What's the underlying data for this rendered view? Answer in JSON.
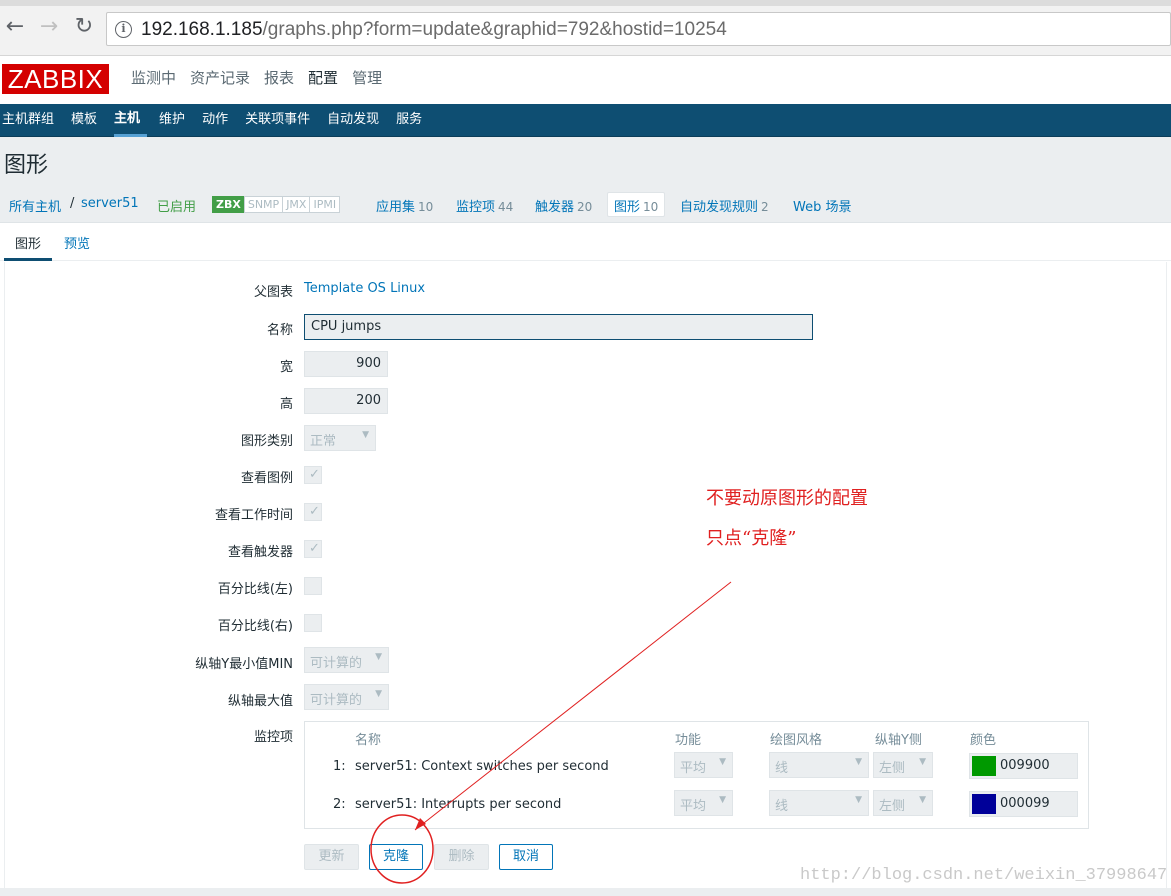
{
  "browser": {
    "url_host": "192.168.1.185",
    "url_rest": "/graphs.php?form=update&graphid=792&hostid=10254",
    "icons": [
      "back-icon",
      "forward-icon",
      "reload-icon",
      "info-icon"
    ]
  },
  "header": {
    "logo": "ZABBIX",
    "menu": [
      "监测中",
      "资产记录",
      "报表",
      "配置",
      "管理"
    ],
    "active_menu": "配置"
  },
  "subnav": {
    "items": [
      "主机群组",
      "模板",
      "主机",
      "维护",
      "动作",
      "关联项事件",
      "自动发现",
      "服务"
    ],
    "active": "主机"
  },
  "page_title": "图形",
  "hostbar": {
    "all_hosts": "所有主机",
    "separator": "/",
    "host": "server51",
    "status": "已启用",
    "badges": [
      "ZBX",
      "SNMP",
      "JMX",
      "IPMI"
    ],
    "apps_label": "应用集",
    "apps_count": "10",
    "items_label": "监控项",
    "items_count": "44",
    "triggers_label": "触发器",
    "triggers_count": "20",
    "graphs_label": "图形",
    "graphs_count": "10",
    "discovery_label": "自动发现规则",
    "discovery_count": "2",
    "web_label": "Web 场景"
  },
  "tabs": [
    "图形",
    "预览"
  ],
  "form": {
    "parent_label": "父图表",
    "parent_value": "Template OS Linux",
    "name_label": "名称",
    "name_value": "CPU jumps",
    "width_label": "宽",
    "width_value": "900",
    "height_label": "高",
    "height_value": "200",
    "type_label": "图形类别",
    "type_value": "正常",
    "legend_label": "查看图例",
    "worktime_label": "查看工作时间",
    "triggers_label": "查看触发器",
    "pct_left_label": "百分比线(左)",
    "pct_right_label": "百分比线(右)",
    "ymin_label": "纵轴Y最小值MIN",
    "ymin_value": "可计算的",
    "ymax_label": "纵轴最大值",
    "ymax_value": "可计算的",
    "items_label": "监控项"
  },
  "items_table": {
    "headers": [
      "名称",
      "功能",
      "绘图风格",
      "纵轴Y侧",
      "颜色"
    ],
    "rows": [
      {
        "index": "1:",
        "name": "server51: Context switches per second",
        "function": "平均",
        "style": "线",
        "yaxis": "左侧",
        "color": "009900",
        "swatch": "#009900"
      },
      {
        "index": "2:",
        "name": "server51: Interrupts per second",
        "function": "平均",
        "style": "线",
        "yaxis": "左侧",
        "color": "000099",
        "swatch": "#000099"
      }
    ]
  },
  "buttons": {
    "update": "更新",
    "clone": "克隆",
    "delete": "删除",
    "cancel": "取消"
  },
  "annotation": {
    "line1": "不要动原图形的配置",
    "line2": "只点“克隆”"
  },
  "watermark": "http://blog.csdn.net/weixin_37998647",
  "colors": {
    "brand_red": "#d40000",
    "nav_blue": "#0e4e72",
    "link_blue": "#0275b8",
    "annotation_red": "#e02020"
  }
}
